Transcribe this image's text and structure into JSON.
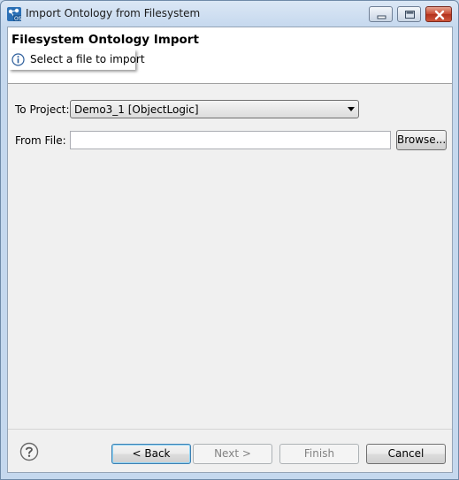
{
  "window": {
    "title": "Import Ontology from Filesystem",
    "icon": "ontology-import-icon",
    "controls": [
      "minimize-icon",
      "maximize-icon",
      "close-icon"
    ]
  },
  "header": {
    "title": "Filesystem Ontology Import",
    "message": "Select a file to import",
    "message_icon": "info-icon"
  },
  "form": {
    "project_label": "To Project:",
    "project_value": "Demo3_1 [ObjectLogic]",
    "file_label": "From File:",
    "file_value": "",
    "browse_label": "Browse..."
  },
  "footer": {
    "help_icon": "help-icon",
    "back_label": "< Back",
    "next_label": "Next >",
    "finish_label": "Finish",
    "cancel_label": "Cancel"
  },
  "colors": {
    "frame": "#c5d8ee",
    "client": "#f0f0f0",
    "close_button": "#c8472f",
    "default_button_border": "#3c7fb1"
  }
}
